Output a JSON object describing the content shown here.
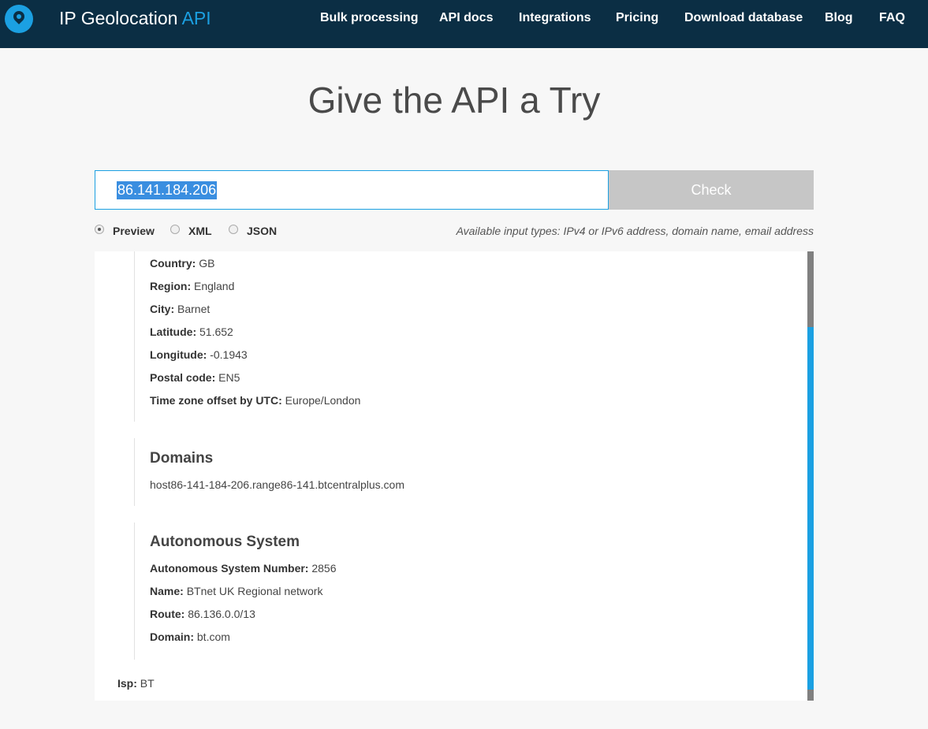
{
  "header": {
    "brand_main": "IP Geolocation",
    "brand_accent": "API",
    "nav": [
      "Bulk processing",
      "API docs",
      "Integrations",
      "Pricing",
      "Download database",
      "Blog",
      "FAQ"
    ]
  },
  "title": "Give the API a Try",
  "search": {
    "value": "86.141.184.206",
    "button": "Check"
  },
  "formats": [
    "Preview",
    "XML",
    "JSON"
  ],
  "selected_format": "Preview",
  "hint": "Available input types: IPv4 or IPv6 address, domain name, email address",
  "location": [
    {
      "label": "Country:",
      "value": "GB"
    },
    {
      "label": "Region:",
      "value": "England"
    },
    {
      "label": "City:",
      "value": "Barnet"
    },
    {
      "label": "Latitude:",
      "value": "51.652"
    },
    {
      "label": "Longitude:",
      "value": "-0.1943"
    },
    {
      "label": "Postal code:",
      "value": "EN5"
    },
    {
      "label": "Time zone offset by UTC:",
      "value": "Europe/London"
    }
  ],
  "domains": {
    "title": "Domains",
    "items": [
      "host86-141-184-206.range86-141.btcentralplus.com"
    ]
  },
  "as": {
    "title": "Autonomous System",
    "rows": [
      {
        "label": "Autonomous System Number:",
        "value": "2856"
      },
      {
        "label": "Name:",
        "value": "BTnet UK Regional network"
      },
      {
        "label": "Route:",
        "value": "86.136.0.0/13"
      },
      {
        "label": "Domain:",
        "value": "bt.com"
      }
    ]
  },
  "isp": {
    "label": "Isp:",
    "value": "BT"
  },
  "colors": {
    "header_bg": "#0b2e44",
    "accent": "#1ba0e2",
    "button_bg": "#c6c6c6"
  }
}
